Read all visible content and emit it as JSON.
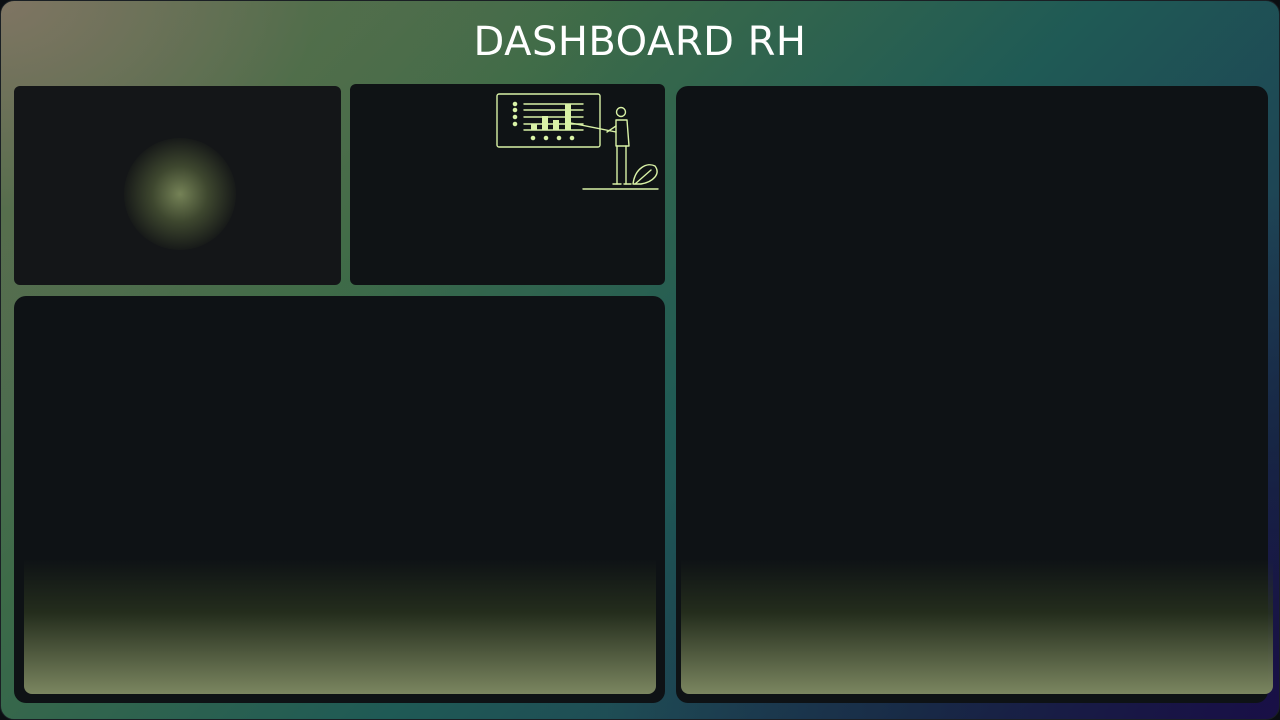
{
  "header": {
    "title": "DASHBOARD RH"
  },
  "colors": {
    "accent": "#d9f2a6",
    "card": "#0f1316",
    "glow": "#7a885a"
  },
  "illustration": {
    "icon": "presenter-with-chart-icon"
  }
}
